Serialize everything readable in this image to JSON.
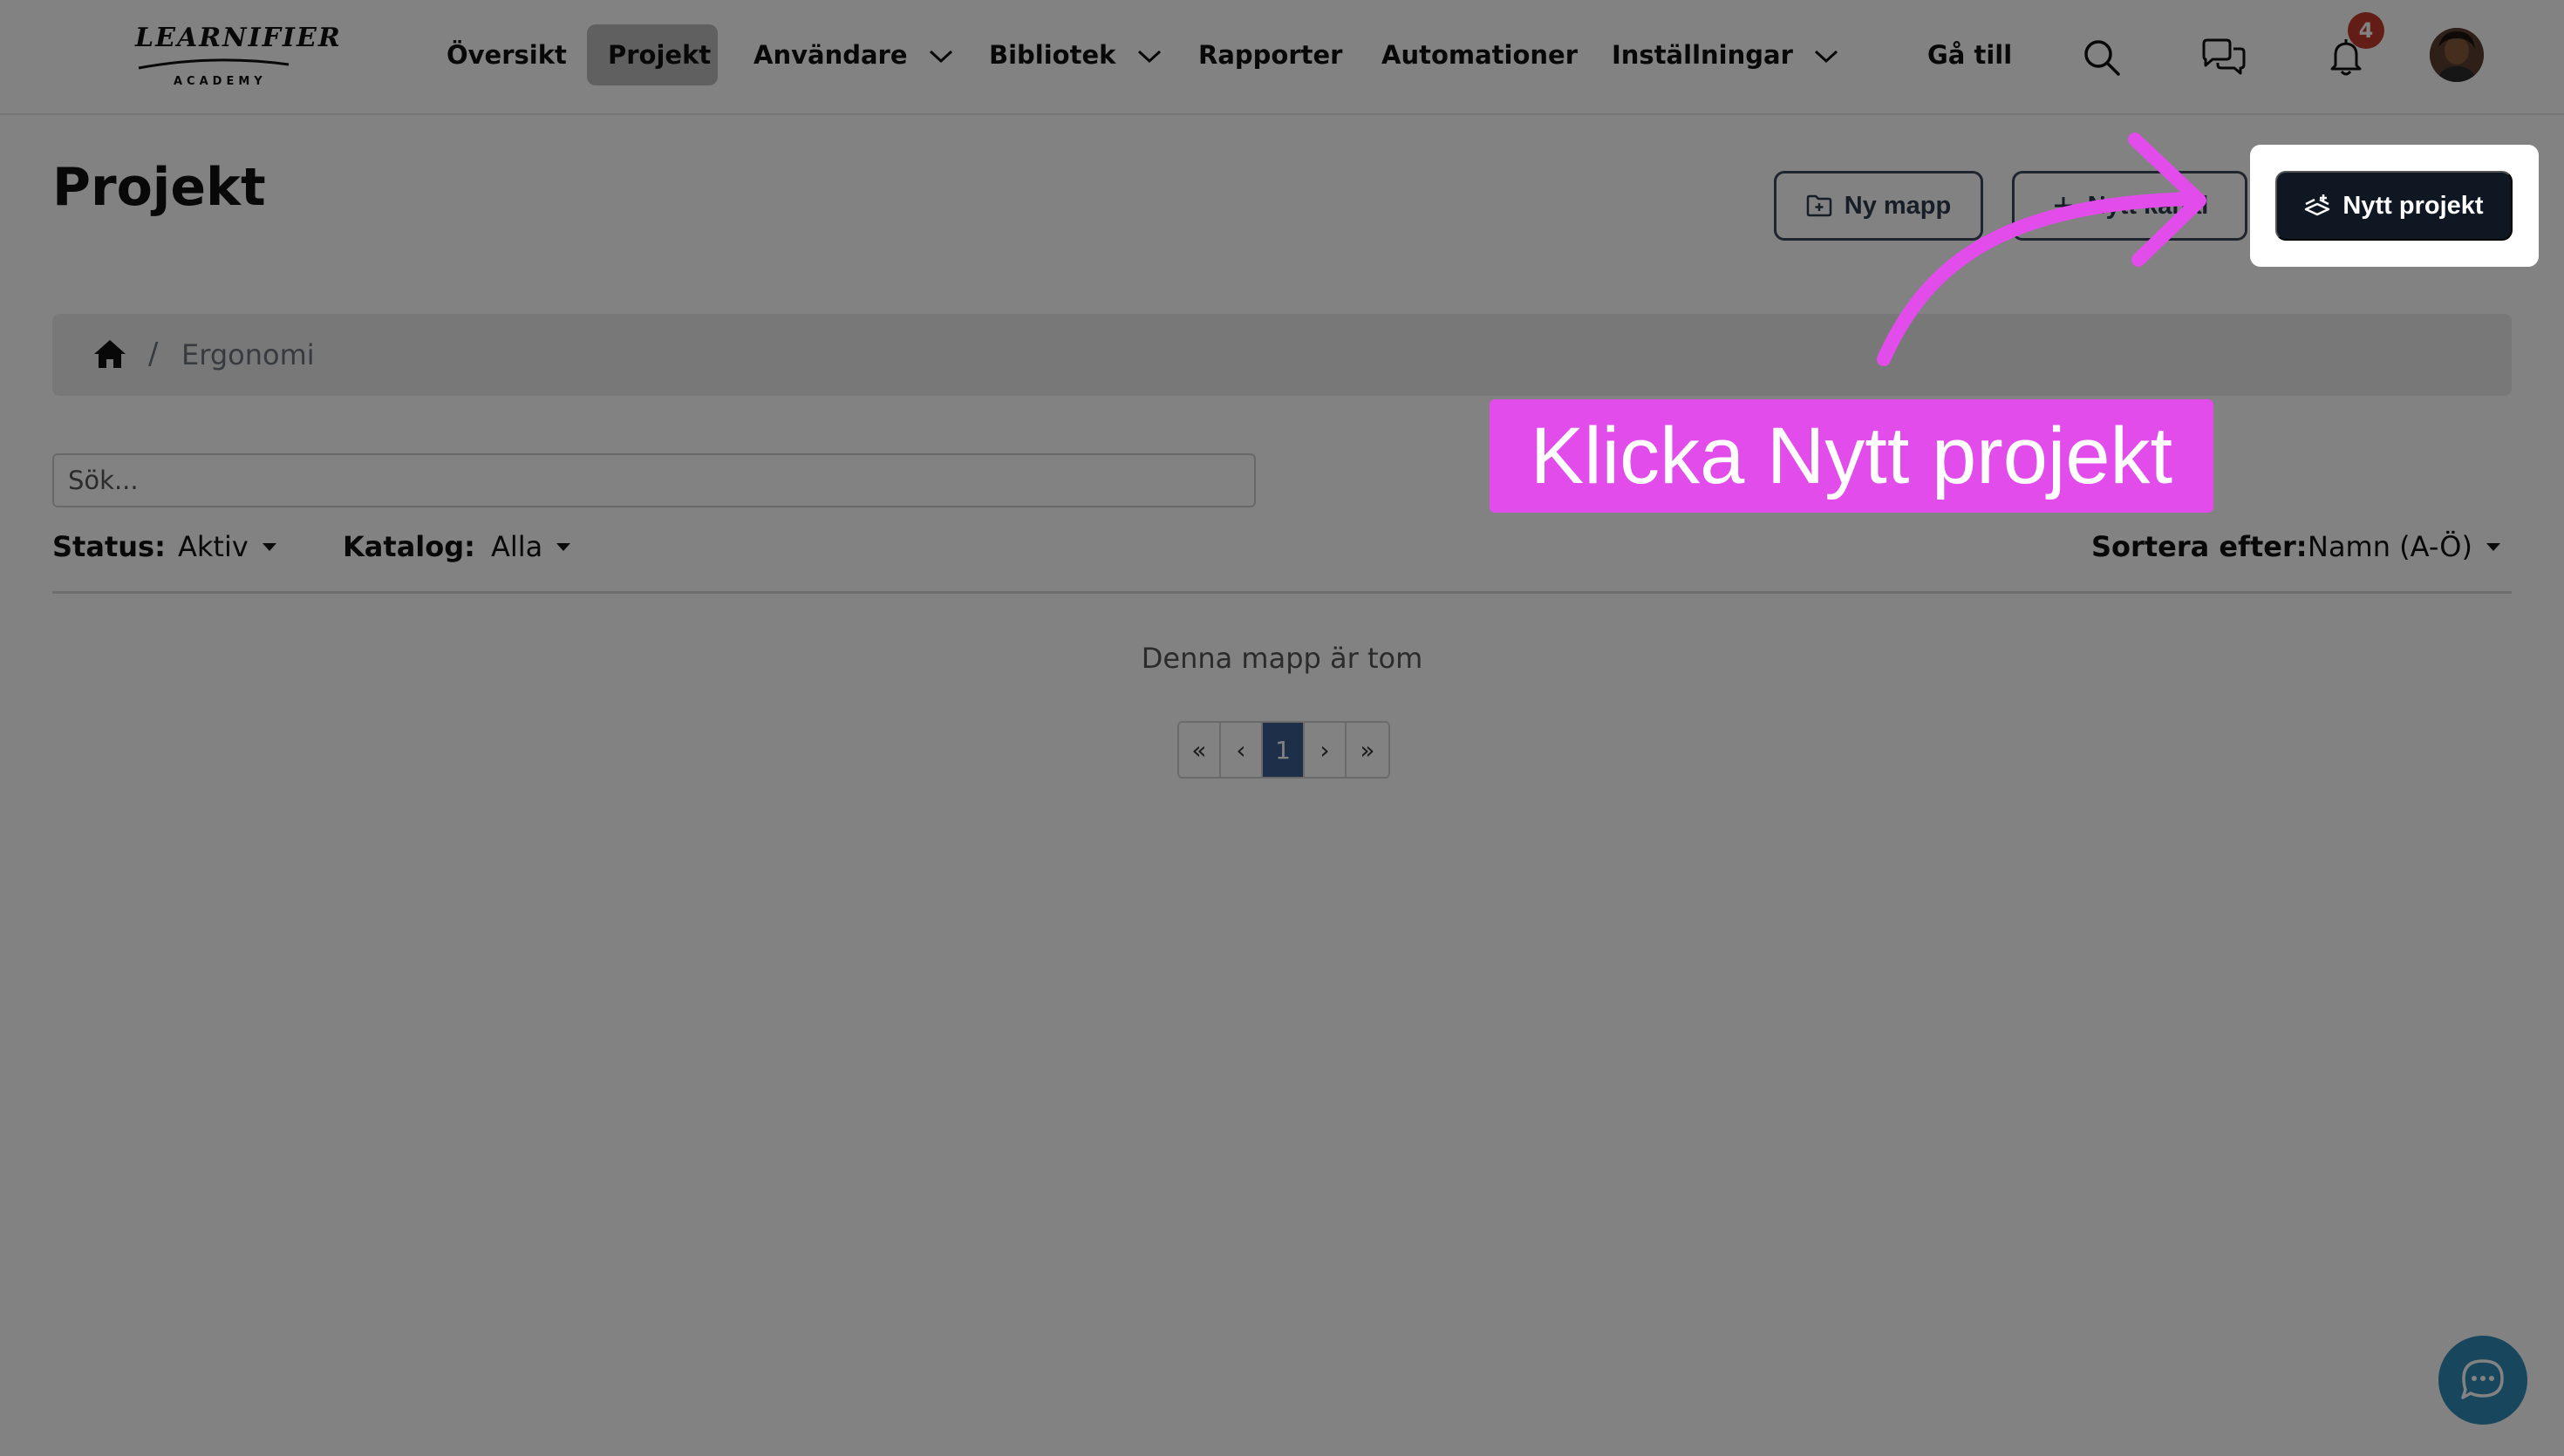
{
  "brand": {
    "name": "LEARNIFIER",
    "sub": "ACADEMY"
  },
  "nav": {
    "items": [
      {
        "label": "Översikt"
      },
      {
        "label": "Projekt"
      },
      {
        "label": "Användare"
      },
      {
        "label": "Bibliotek"
      },
      {
        "label": "Rapporter"
      },
      {
        "label": "Automationer"
      },
      {
        "label": "Inställningar"
      }
    ],
    "goto_label": "Gå till",
    "notification_count": "4"
  },
  "page": {
    "title": "Projekt",
    "buttons": {
      "new_folder": "Ny mapp",
      "new_channel": "Nytt kanal",
      "new_project": "Nytt projekt"
    },
    "breadcrumb": {
      "current": "Ergonomi",
      "separator": "/"
    },
    "search": {
      "placeholder": "Sök...",
      "value": ""
    },
    "filters": {
      "status_label": "Status:",
      "status_value": "Aktiv",
      "catalog_label": "Katalog:",
      "catalog_value": "Alla",
      "sort_label": "Sortera efter:",
      "sort_value": "Namn (A-Ö)"
    },
    "empty_message": "Denna mapp är tom",
    "pagination": {
      "first": "«",
      "prev": "‹",
      "current": "1",
      "next": "›",
      "last": "»"
    }
  },
  "tutorial": {
    "callout": "Klicka Nytt projekt",
    "highlight_color": "#e24cea"
  },
  "colors": {
    "primary_button": "#0f1722",
    "pager_active": "#3b5f8f",
    "chat_button": "#2f8ab7",
    "badge": "#c0392b"
  }
}
